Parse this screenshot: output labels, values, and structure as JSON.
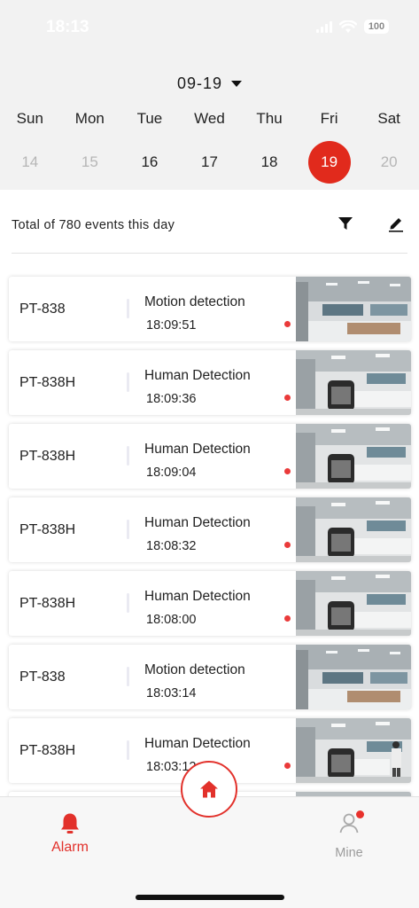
{
  "status_bar": {
    "time": "18:13",
    "battery": "100"
  },
  "header": {
    "month_day": "09-19",
    "days": [
      {
        "name": "Sun",
        "num": "14",
        "state": "dim"
      },
      {
        "name": "Mon",
        "num": "15",
        "state": "dim"
      },
      {
        "name": "Tue",
        "num": "16",
        "state": "normal"
      },
      {
        "name": "Wed",
        "num": "17",
        "state": "normal"
      },
      {
        "name": "Thu",
        "num": "18",
        "state": "normal"
      },
      {
        "name": "Fri",
        "num": "19",
        "state": "selected"
      },
      {
        "name": "Sat",
        "num": "20",
        "state": "dim"
      }
    ]
  },
  "summary": {
    "text": "Total of 780 events this day",
    "filter_icon": "filter-icon",
    "edit_icon": "edit-icon"
  },
  "events": [
    {
      "device": "PT-838",
      "type": "Motion detection",
      "time": "18:09:51",
      "unread": true
    },
    {
      "device": "PT-838H",
      "type": "Human Detection",
      "time": "18:09:36",
      "unread": true
    },
    {
      "device": "PT-838H",
      "type": "Human Detection",
      "time": "18:09:04",
      "unread": true
    },
    {
      "device": "PT-838H",
      "type": "Human Detection",
      "time": "18:08:32",
      "unread": true
    },
    {
      "device": "PT-838H",
      "type": "Human Detection",
      "time": "18:08:00",
      "unread": true
    },
    {
      "device": "PT-838",
      "type": "Motion detection",
      "time": "18:03:14",
      "unread": false
    },
    {
      "device": "PT-838H",
      "type": "Human Detection",
      "time": "18:03:12",
      "unread": true
    }
  ],
  "tabbar": {
    "alarm_label": "Alarm",
    "mine_label": "Mine",
    "home_icon": "home-icon"
  },
  "colors": {
    "accent": "#e2312b",
    "selected_day": "#e12a1c",
    "unread_dot": "#ea3a3a"
  }
}
